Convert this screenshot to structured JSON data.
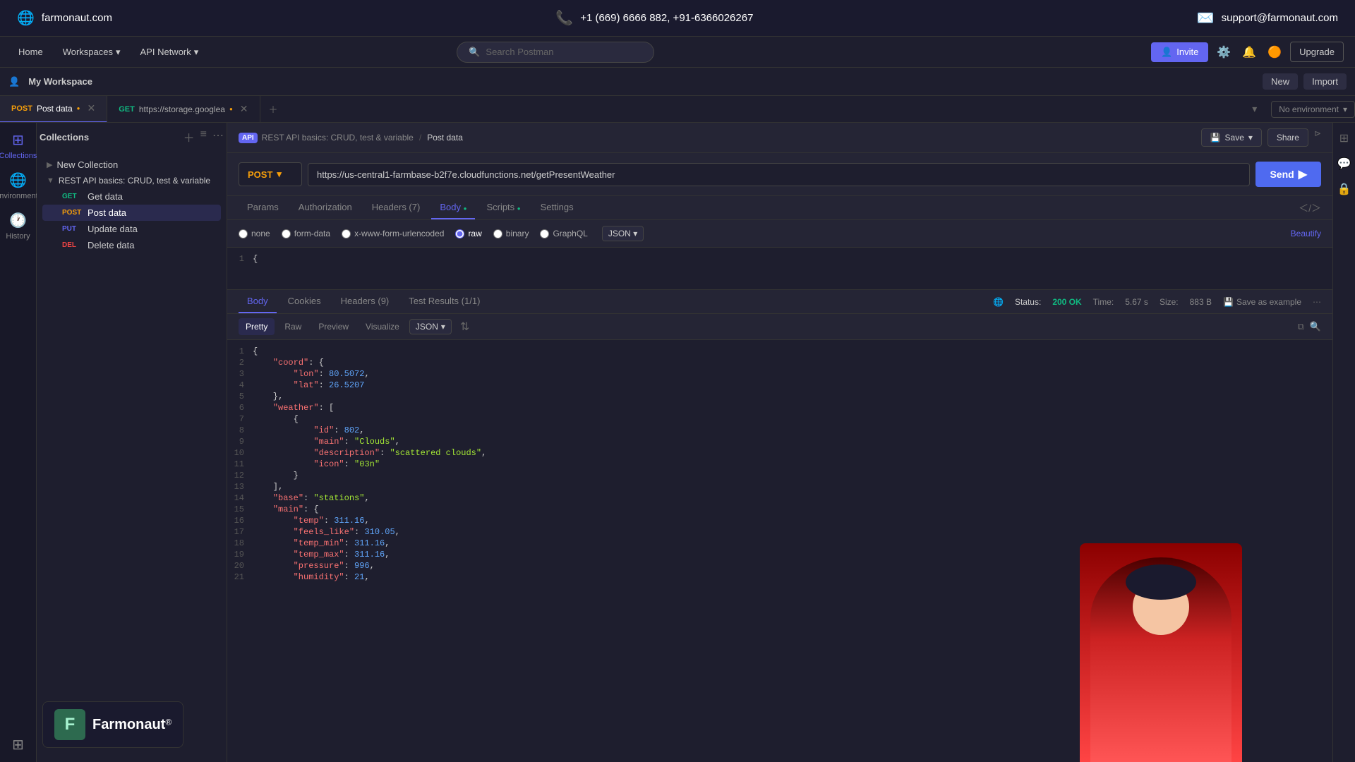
{
  "banner": {
    "website": "farmonaut.com",
    "phone": "+1 (669) 6666 882, +91-6366026267",
    "email": "support@farmonaut.com"
  },
  "nav": {
    "home": "Home",
    "workspaces": "Workspaces",
    "api_network": "API Network",
    "search_placeholder": "Search Postman",
    "invite_label": "Invite",
    "upgrade_label": "Upgrade",
    "no_environment": "No environment"
  },
  "workspace": {
    "name": "My Workspace",
    "new_btn": "New",
    "import_btn": "Import"
  },
  "tabs": [
    {
      "method": "POST",
      "label": "Post data",
      "active": true,
      "has_dot": true
    },
    {
      "method": "GET",
      "label": "https://storage.googlea",
      "active": false,
      "has_dot": true
    }
  ],
  "sidebar": {
    "collections_label": "Collections",
    "environments_label": "Environments",
    "history_label": "History",
    "new_collection": "New Collection",
    "collection_name": "REST API basics: CRUD, test & variable",
    "items": [
      {
        "method": "GET",
        "label": "Get data"
      },
      {
        "method": "POST",
        "label": "Post data",
        "active": true
      },
      {
        "method": "PUT",
        "label": "Update data"
      },
      {
        "method": "DEL",
        "label": "Delete data"
      }
    ]
  },
  "breadcrumb": {
    "api": "REST API basics: CRUD, test & variable",
    "separator": "/",
    "current": "Post data",
    "save_label": "Save",
    "share_label": "Share"
  },
  "request": {
    "method": "POST",
    "url": "https://us-central1-farmbase-b2f7e.cloudfunctions.net/getPresentWeather",
    "send_label": "Send",
    "tabs": [
      {
        "label": "Params"
      },
      {
        "label": "Authorization"
      },
      {
        "label": "Headers (7)"
      },
      {
        "label": "Body",
        "active": true,
        "has_dot": true
      },
      {
        "label": "Scripts",
        "has_dot": true
      },
      {
        "label": "Settings"
      }
    ],
    "body_options": [
      {
        "id": "none",
        "label": "none"
      },
      {
        "id": "form-data",
        "label": "form-data"
      },
      {
        "id": "x-www-form-urlencoded",
        "label": "x-www-form-urlencoded"
      },
      {
        "id": "raw",
        "label": "raw",
        "selected": true
      },
      {
        "id": "binary",
        "label": "binary"
      },
      {
        "id": "graphql",
        "label": "GraphQL"
      }
    ],
    "body_format": "JSON",
    "beautify_label": "Beautify",
    "body_line_num": "1",
    "body_content": "{"
  },
  "response": {
    "tabs": [
      {
        "label": "Body",
        "active": true
      },
      {
        "label": "Cookies"
      },
      {
        "label": "Headers (9)"
      },
      {
        "label": "Test Results (1/1)"
      }
    ],
    "status_label": "Status:",
    "status_value": "200 OK",
    "time_label": "Time:",
    "time_value": "5.67 s",
    "size_label": "Size:",
    "size_value": "883 B",
    "save_example": "Save as example",
    "view_tabs": [
      {
        "label": "Pretty",
        "active": true
      },
      {
        "label": "Raw"
      },
      {
        "label": "Preview"
      },
      {
        "label": "Visualize"
      }
    ],
    "format": "JSON",
    "lines": [
      {
        "num": "1",
        "content": "{"
      },
      {
        "num": "2",
        "content": "    \"coord\": {"
      },
      {
        "num": "3",
        "content": "        \"lon\": 80.5072,"
      },
      {
        "num": "4",
        "content": "        \"lat\": 26.5207"
      },
      {
        "num": "5",
        "content": "    },"
      },
      {
        "num": "6",
        "content": "    \"weather\": ["
      },
      {
        "num": "7",
        "content": "        {"
      },
      {
        "num": "8",
        "content": "            \"id\": 802,"
      },
      {
        "num": "9",
        "content": "            \"main\": \"Clouds\","
      },
      {
        "num": "10",
        "content": "            \"description\": \"scattered clouds\","
      },
      {
        "num": "11",
        "content": "            \"icon\": \"03n\""
      },
      {
        "num": "12",
        "content": "        }"
      },
      {
        "num": "13",
        "content": "    ],"
      },
      {
        "num": "14",
        "content": "    \"base\": \"stations\","
      },
      {
        "num": "15",
        "content": "    \"main\": {"
      },
      {
        "num": "16",
        "content": "        \"temp\": 311.16,"
      },
      {
        "num": "17",
        "content": "        \"feels_like\": 310.05,"
      },
      {
        "num": "18",
        "content": "        \"temp_min\": 311.16,"
      },
      {
        "num": "19",
        "content": "        \"temp_max\": 311.16,"
      },
      {
        "num": "20",
        "content": "        \"pressure\": 996,"
      },
      {
        "num": "21",
        "content": "        \"humidity\": 21,"
      }
    ]
  },
  "farmonaut": {
    "logo_char": "F",
    "name": "Farmonaut",
    "registered": "®"
  }
}
